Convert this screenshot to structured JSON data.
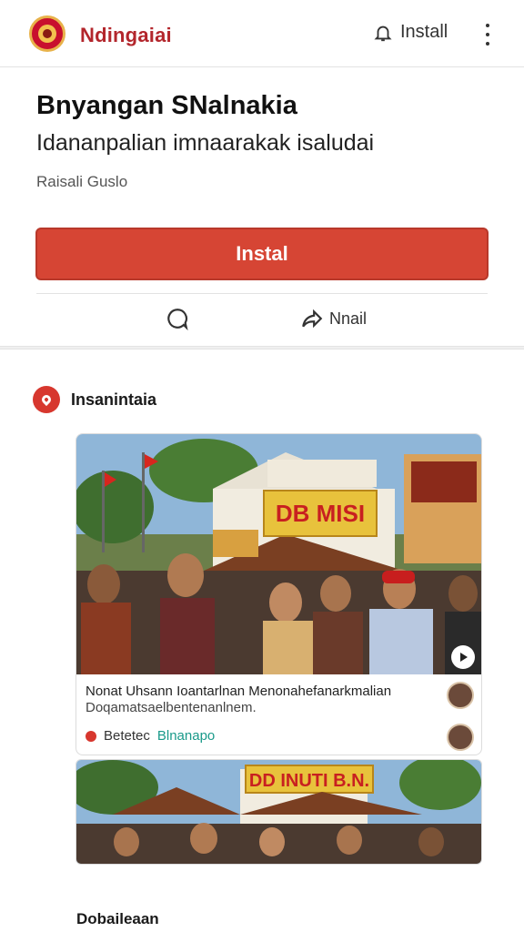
{
  "topbar": {
    "brand": "Ndingaiai",
    "install_label": "Install"
  },
  "header": {
    "title": "Bnyangan SNalnakia",
    "subtitle": "Idananpalian imnaarakak isaludai",
    "meta": "Raisali Guslo",
    "install_button": "Instal",
    "share_label": "Nnail"
  },
  "feed": {
    "section_label": "Insanintaia",
    "card": {
      "banner_text": "DB MISI",
      "caption": "Nonat Uhsann Ioantarlnan Menonahefanarkmalian",
      "sub": "Doqamatsaelbentenanlnem.",
      "source_prefix": "Betetec",
      "source_name": "Blnanapo"
    },
    "second_banner_text": "DD INUTI B.N.",
    "footer_label": "Dobaileaan"
  },
  "colors": {
    "brand_red": "#b3262c",
    "button_red": "#d64534"
  }
}
